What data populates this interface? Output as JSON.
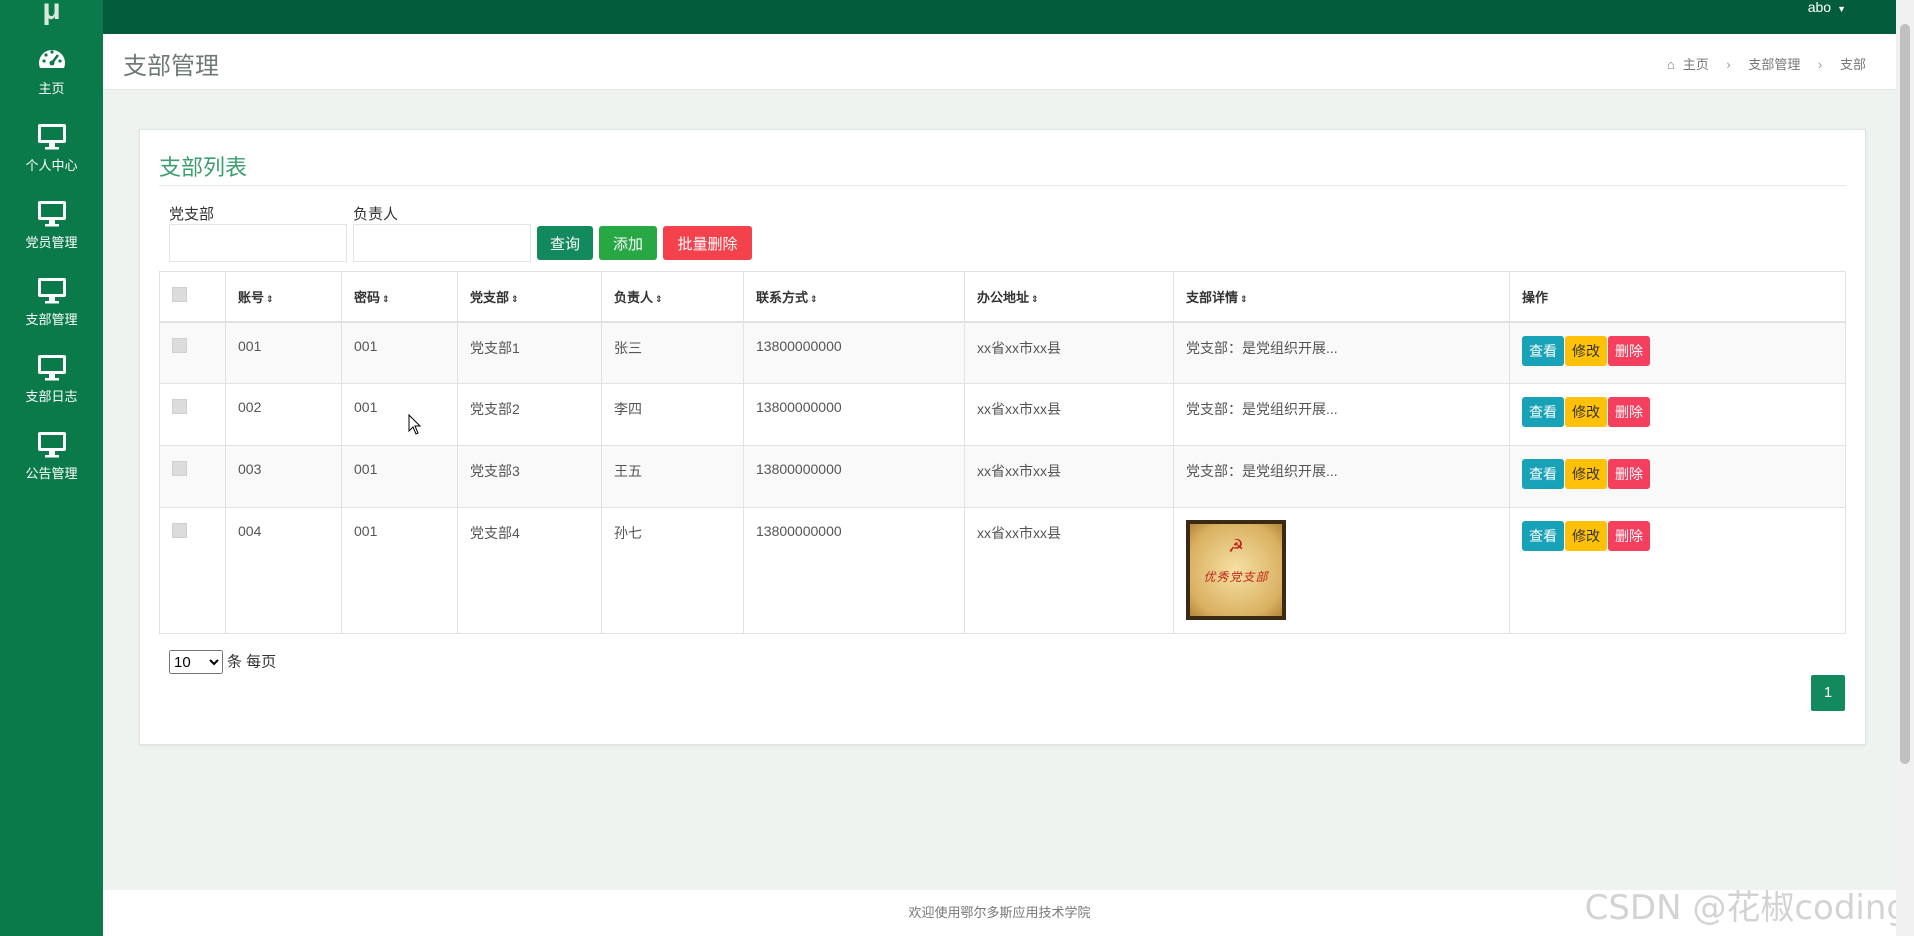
{
  "app": {
    "logo": "μ",
    "user": "abo"
  },
  "sidebar": {
    "items": [
      {
        "label": "主页",
        "icon": "dashboard-icon"
      },
      {
        "label": "个人中心",
        "icon": "monitor-icon"
      },
      {
        "label": "党员管理",
        "icon": "monitor-icon"
      },
      {
        "label": "支部管理",
        "icon": "monitor-icon"
      },
      {
        "label": "支部日志",
        "icon": "monitor-icon"
      },
      {
        "label": "公告管理",
        "icon": "monitor-icon"
      }
    ]
  },
  "header": {
    "title": "支部管理",
    "breadcrumb": [
      "主页",
      "支部管理",
      "支部"
    ]
  },
  "panel": {
    "title": "支部列表",
    "filters": {
      "branch_label": "党支部",
      "branch_value": "",
      "leader_label": "负责人",
      "leader_value": ""
    },
    "buttons": {
      "query": "查询",
      "add": "添加",
      "bulk_delete": "批量删除"
    },
    "columns": [
      "账号",
      "密码",
      "党支部",
      "负责人",
      "联系方式",
      "办公地址",
      "支部详情",
      "操作"
    ],
    "rows": [
      {
        "account": "001",
        "password": "001",
        "branch": "党支部1",
        "leader": "张三",
        "phone": "13800000000",
        "address": "xx省xx市xx县",
        "detail": "党支部：是党组织开展..."
      },
      {
        "account": "002",
        "password": "001",
        "branch": "党支部2",
        "leader": "李四",
        "phone": "13800000000",
        "address": "xx省xx市xx县",
        "detail": "党支部：是党组织开展..."
      },
      {
        "account": "003",
        "password": "001",
        "branch": "党支部3",
        "leader": "王五",
        "phone": "13800000000",
        "address": "xx省xx市xx县",
        "detail": "党支部：是党组织开展..."
      },
      {
        "account": "004",
        "password": "001",
        "branch": "党支部4",
        "leader": "孙七",
        "phone": "13800000000",
        "address": "xx省xx市xx县",
        "detail": ""
      }
    ],
    "row_actions": {
      "view": "查看",
      "edit": "修改",
      "delete": "删除"
    },
    "image_caption": "优秀党支部",
    "pagination": {
      "page_size": "10",
      "page_size_suffix": "条 每页",
      "current_page": "1"
    }
  },
  "footer": {
    "text": "欢迎使用鄂尔多斯应用技术学院"
  },
  "watermark": "CSDN @花椒coding",
  "colors": {
    "primary": "#0b7a4b",
    "topbar": "#035c3b",
    "accent": "#138a5d",
    "danger": "#f4424d",
    "info": "#17a2b8",
    "warning": "#ffc107"
  }
}
